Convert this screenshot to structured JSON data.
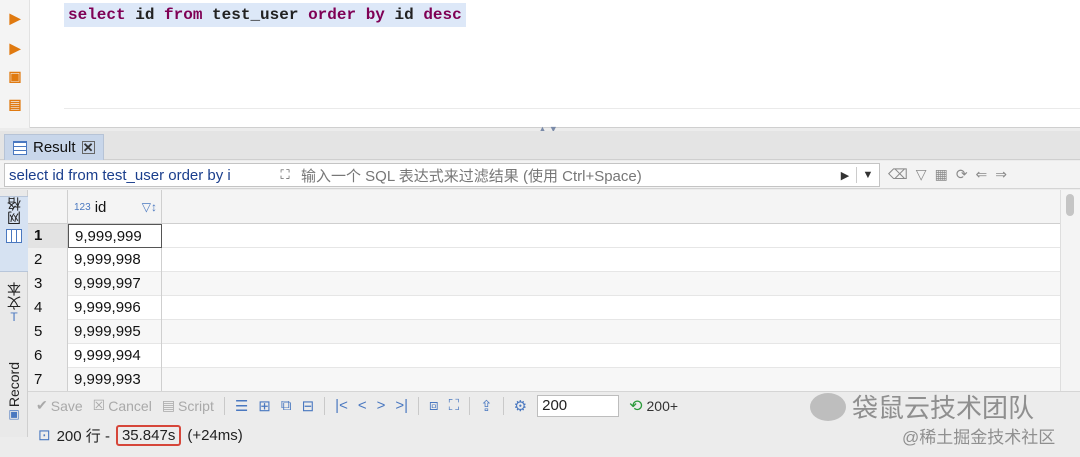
{
  "editor": {
    "sql_keyword_select": "select",
    "sql_id": "id",
    "sql_from": "from",
    "sql_table": "test_user",
    "sql_order": "order",
    "sql_by": "by",
    "sql_order_col": "id",
    "sql_desc": "desc",
    "gutter_icons": [
      "run-statement-icon",
      "run-script-icon",
      "explain-icon",
      "load-plan-icon"
    ]
  },
  "result_tab": {
    "label": "Result",
    "close": "✕"
  },
  "filter": {
    "query_text": "select id from test_user order by i",
    "placeholder": "输入一个 SQL 表达式来过滤结果 (使用 Ctrl+Space)"
  },
  "side_tabs": {
    "grid": "网格",
    "text": "文本",
    "record": "Record"
  },
  "grid": {
    "column_type": "123",
    "column_name": "id",
    "rows": [
      {
        "n": "1",
        "value": "9,999,999"
      },
      {
        "n": "2",
        "value": "9,999,998"
      },
      {
        "n": "3",
        "value": "9,999,997"
      },
      {
        "n": "4",
        "value": "9,999,996"
      },
      {
        "n": "5",
        "value": "9,999,995"
      },
      {
        "n": "6",
        "value": "9,999,994"
      },
      {
        "n": "7",
        "value": "9,999,993"
      }
    ]
  },
  "toolbar": {
    "save": "Save",
    "cancel": "Cancel",
    "script": "Script",
    "fetch_size": "200",
    "fetch_next": "200+"
  },
  "status": {
    "rows": "200 行 -",
    "time": "35.847s",
    "extra": "(+24ms)"
  },
  "watermark": {
    "title": "袋鼠云技术团队",
    "subtitle": "@稀土掘金技术社区"
  },
  "colors": {
    "keyword": "#7f0055",
    "accent": "#4a78c0",
    "highlight_box": "#d6463a",
    "gutter_icon": "#e07a10"
  }
}
